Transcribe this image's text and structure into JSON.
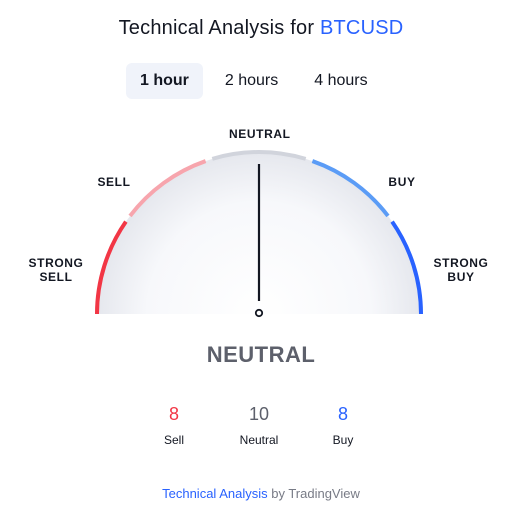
{
  "header": {
    "title_prefix": "Technical Analysis for",
    "symbol": "BTCUSD"
  },
  "tabs": [
    {
      "label": "1 hour",
      "active": true
    },
    {
      "label": "2 hours",
      "active": false
    },
    {
      "label": "4 hours",
      "active": false
    }
  ],
  "gauge": {
    "labels": {
      "strong_sell": [
        "STRONG",
        "SELL"
      ],
      "sell": "SELL",
      "neutral": "NEUTRAL",
      "buy": "BUY",
      "strong_buy": [
        "STRONG",
        "BUY"
      ]
    },
    "needle_value": 0,
    "colors": {
      "strong_sell": "#f23645",
      "sell": "#f7a5ad",
      "neutral": "#d1d4dc",
      "buy": "#5b9cf6",
      "strong_buy": "#2962ff"
    }
  },
  "verdict": "NEUTRAL",
  "counters": {
    "sell": {
      "value": "8",
      "label": "Sell",
      "color": "#f23645"
    },
    "neutral": {
      "value": "10",
      "label": "Neutral",
      "color": "#5d606b"
    },
    "buy": {
      "value": "8",
      "label": "Buy",
      "color": "#2962ff"
    }
  },
  "footer": {
    "link_text": "Technical Analysis",
    "by_text": "by TradingView"
  }
}
